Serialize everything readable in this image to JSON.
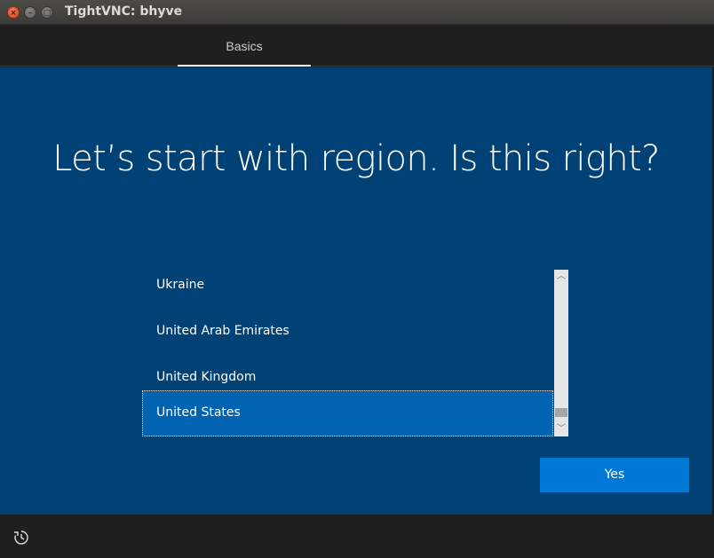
{
  "window": {
    "title": "TightVNC: bhyve",
    "close_glyph": "×",
    "minimize_glyph": "–",
    "maximize_glyph": "□"
  },
  "tabs": [
    {
      "label": "Basics",
      "active": true
    }
  ],
  "heading": "Let’s start with region. Is this right?",
  "region_list": {
    "items": [
      {
        "label": "Ukraine",
        "selected": false
      },
      {
        "label": "United Arab Emirates",
        "selected": false
      },
      {
        "label": "United Kingdom",
        "selected": false
      },
      {
        "label": "United States",
        "selected": true
      }
    ],
    "scroll_up_glyph": "︿",
    "scroll_down_glyph": "﹀"
  },
  "yes_button": {
    "label": "Yes"
  },
  "icons": {
    "accessibility": "ease-of-access-icon"
  },
  "colors": {
    "background": "#004275",
    "selected_item": "#0063b1",
    "button": "#0078d7",
    "chrome": "#1f1f1f"
  }
}
